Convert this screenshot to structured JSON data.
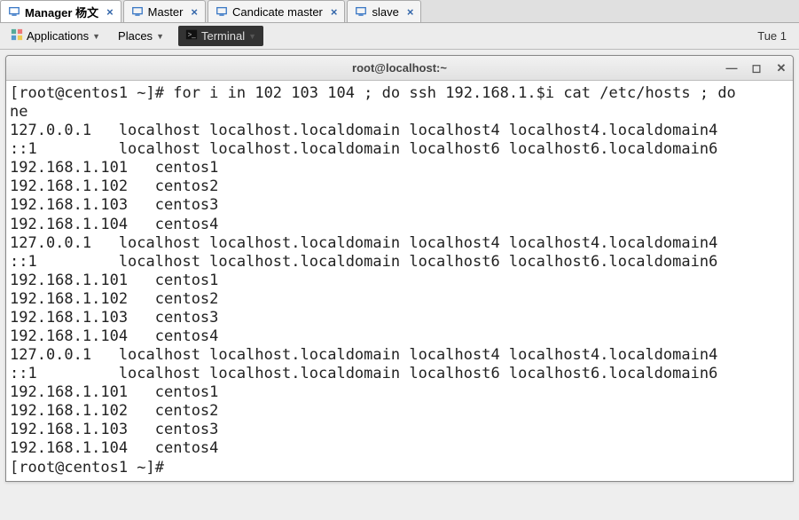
{
  "tabs": [
    {
      "label": "Manager 杨文",
      "active": true
    },
    {
      "label": "Master",
      "active": false
    },
    {
      "label": "Candicate master",
      "active": false
    },
    {
      "label": "slave",
      "active": false
    }
  ],
  "menu": {
    "applications": "Applications",
    "places": "Places",
    "terminal": "Terminal",
    "clock": "Tue 1"
  },
  "window": {
    "title": "root@localhost:~"
  },
  "terminal": {
    "lines": [
      "[root@centos1 ~]# for i in 102 103 104 ; do ssh 192.168.1.$i cat /etc/hosts ; do",
      "ne",
      "127.0.0.1   localhost localhost.localdomain localhost4 localhost4.localdomain4",
      "::1         localhost localhost.localdomain localhost6 localhost6.localdomain6",
      "192.168.1.101   centos1",
      "192.168.1.102   centos2",
      "192.168.1.103   centos3",
      "192.168.1.104   centos4",
      "127.0.0.1   localhost localhost.localdomain localhost4 localhost4.localdomain4",
      "::1         localhost localhost.localdomain localhost6 localhost6.localdomain6",
      "192.168.1.101   centos1",
      "192.168.1.102   centos2",
      "192.168.1.103   centos3",
      "192.168.1.104   centos4",
      "127.0.0.1   localhost localhost.localdomain localhost4 localhost4.localdomain4",
      "::1         localhost localhost.localdomain localhost6 localhost6.localdomain6",
      "192.168.1.101   centos1",
      "192.168.1.102   centos2",
      "192.168.1.103   centos3",
      "192.168.1.104   centos4",
      "[root@centos1 ~]# "
    ]
  }
}
